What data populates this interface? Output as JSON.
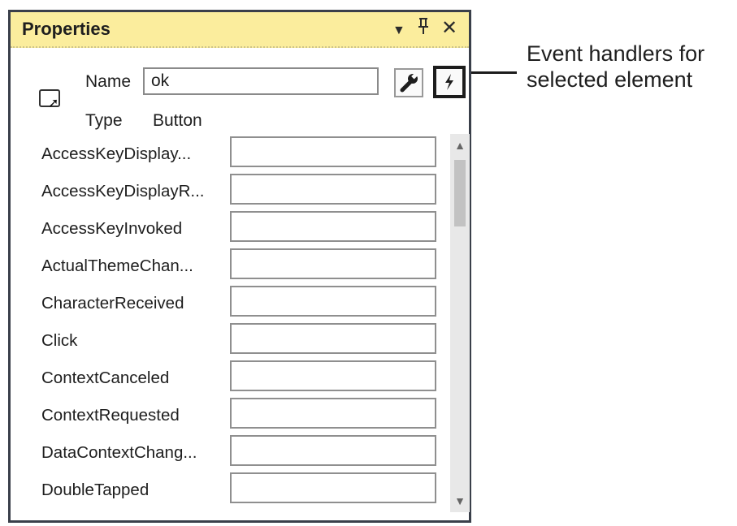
{
  "panel": {
    "title": "Properties",
    "controls": {
      "dropdown": "▼",
      "pin": "ꟼ",
      "close": "✕"
    }
  },
  "header": {
    "name_label": "Name",
    "name_value": "ok",
    "type_label": "Type",
    "type_value": "Button",
    "icons": [
      "selection-icon",
      "wrench-icon",
      "lightning-bolt-icon"
    ]
  },
  "events": [
    "AccessKeyDisplay...",
    "AccessKeyDisplayR...",
    "AccessKeyInvoked",
    "ActualThemeChan...",
    "CharacterReceived",
    "Click",
    "ContextCanceled",
    "ContextRequested",
    "DataContextChang...",
    "DoubleTapped"
  ],
  "callout": {
    "line1": "Event handlers for",
    "line2": "selected element"
  },
  "colors": {
    "titlebar": "#fbed9d",
    "border": "#3a3f4a"
  }
}
